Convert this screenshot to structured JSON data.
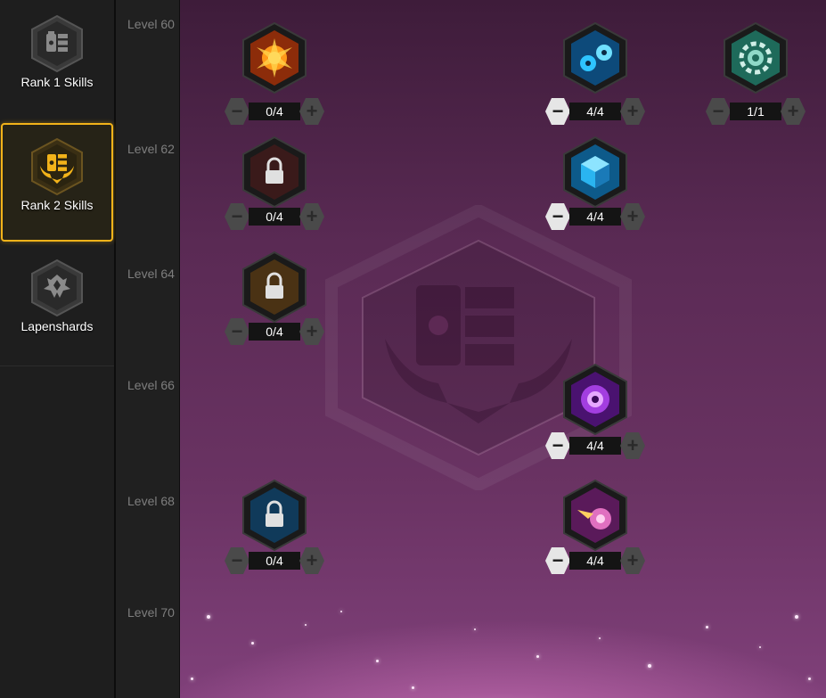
{
  "sidebar": {
    "tabs": [
      {
        "label": "Rank 1 Skills",
        "icon": "rank1-cards-icon",
        "selected": false
      },
      {
        "label": "Rank 2 Skills",
        "icon": "rank2-cards-wings-icon",
        "selected": true
      },
      {
        "label": "Lapenshards",
        "icon": "lapenshard-crystal-icon",
        "selected": false
      }
    ]
  },
  "levels": [
    "Level 60",
    "Level 62",
    "Level 64",
    "Level 66",
    "Level 68",
    "Level 70"
  ],
  "skills": [
    {
      "level": "Level 60",
      "points": "0/4",
      "locked": false,
      "icon": "orange-burst-icon"
    },
    {
      "level": "Level 60",
      "points": "4/4",
      "locked": false,
      "icon": "blue-robots-icon"
    },
    {
      "level": "Level 60",
      "points": "1/1",
      "locked": false,
      "icon": "green-gear-icon"
    },
    {
      "level": "Level 62",
      "points": "0/4",
      "locked": true,
      "icon": "lock-icon"
    },
    {
      "level": "Level 62",
      "points": "4/4",
      "locked": false,
      "icon": "blue-cube-icon"
    },
    {
      "level": "Level 64",
      "points": "0/4",
      "locked": true,
      "icon": "lock-icon"
    },
    {
      "level": "Level 66",
      "points": "4/4",
      "locked": false,
      "icon": "purple-vortex-icon"
    },
    {
      "level": "Level 68",
      "points": "0/4",
      "locked": true,
      "icon": "lock-icon"
    },
    {
      "level": "Level 68",
      "points": "4/4",
      "locked": false,
      "icon": "pink-burst-icon"
    }
  ],
  "colors": {
    "selected_tab_border": "#f2b31a",
    "board_top": "#3e1c3a",
    "board_bottom": "#80407a",
    "active_minus": "#e6e6e6",
    "inactive_button": "#4a4a4a"
  }
}
